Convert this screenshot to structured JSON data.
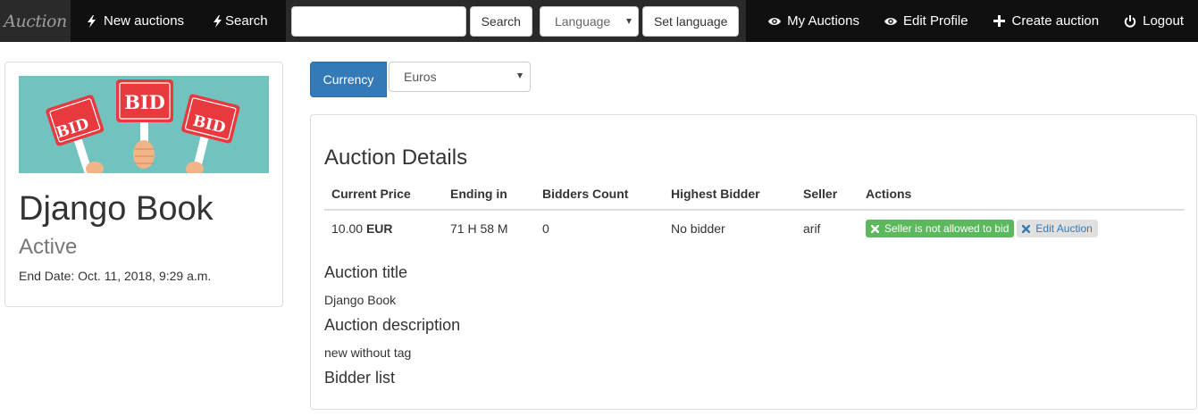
{
  "brand": "Auction",
  "nav": {
    "new_auctions": "New auctions",
    "search_link": "Search",
    "search_placeholder": "",
    "search_button": "Search",
    "language_selected": "Language",
    "set_language": "Set language",
    "my_auctions": "My Auctions",
    "edit_profile": "Edit Profile",
    "create_auction": "Create auction",
    "logout": "Logout"
  },
  "item": {
    "banner_words": [
      "BID",
      "BID",
      "BID"
    ],
    "title": "Django Book",
    "status": "Active",
    "end_date": "End Date: Oct. 11, 2018, 9:29 a.m."
  },
  "currency": {
    "button_label": "Currency",
    "selected": "Euros"
  },
  "details": {
    "heading": "Auction Details",
    "columns": [
      "Current Price",
      "Ending in",
      "Bidders Count",
      "Highest Bidder",
      "Seller",
      "Actions"
    ],
    "row": {
      "price_value": "10.00",
      "price_currency": "EUR",
      "ending_in": "71 H 58 M",
      "bidders_count": "0",
      "highest_bidder": "No bidder",
      "seller": "arif",
      "action_disabled": "Seller is not allowed to bid",
      "action_edit": "Edit Auction"
    },
    "title_label": "Auction title",
    "title_value": "Django Book",
    "description_label": "Auction description",
    "description_value": "new without tag",
    "bidder_list_label": "Bidder list"
  },
  "colors": {
    "navbar_bg": "#101010",
    "primary": "#337ab7",
    "success": "#5cb85c",
    "banner_bg": "#72c3bf",
    "sign_red": "#e8393f"
  },
  "icons": {
    "new_auctions": "lightning-icon",
    "search": "lightning-icon",
    "my_auctions": "eye-icon",
    "edit_profile": "eye-icon",
    "create_auction": "plus-icon",
    "logout": "power-icon",
    "action_disabled": "cross-icon",
    "action_edit": "cross-icon"
  }
}
